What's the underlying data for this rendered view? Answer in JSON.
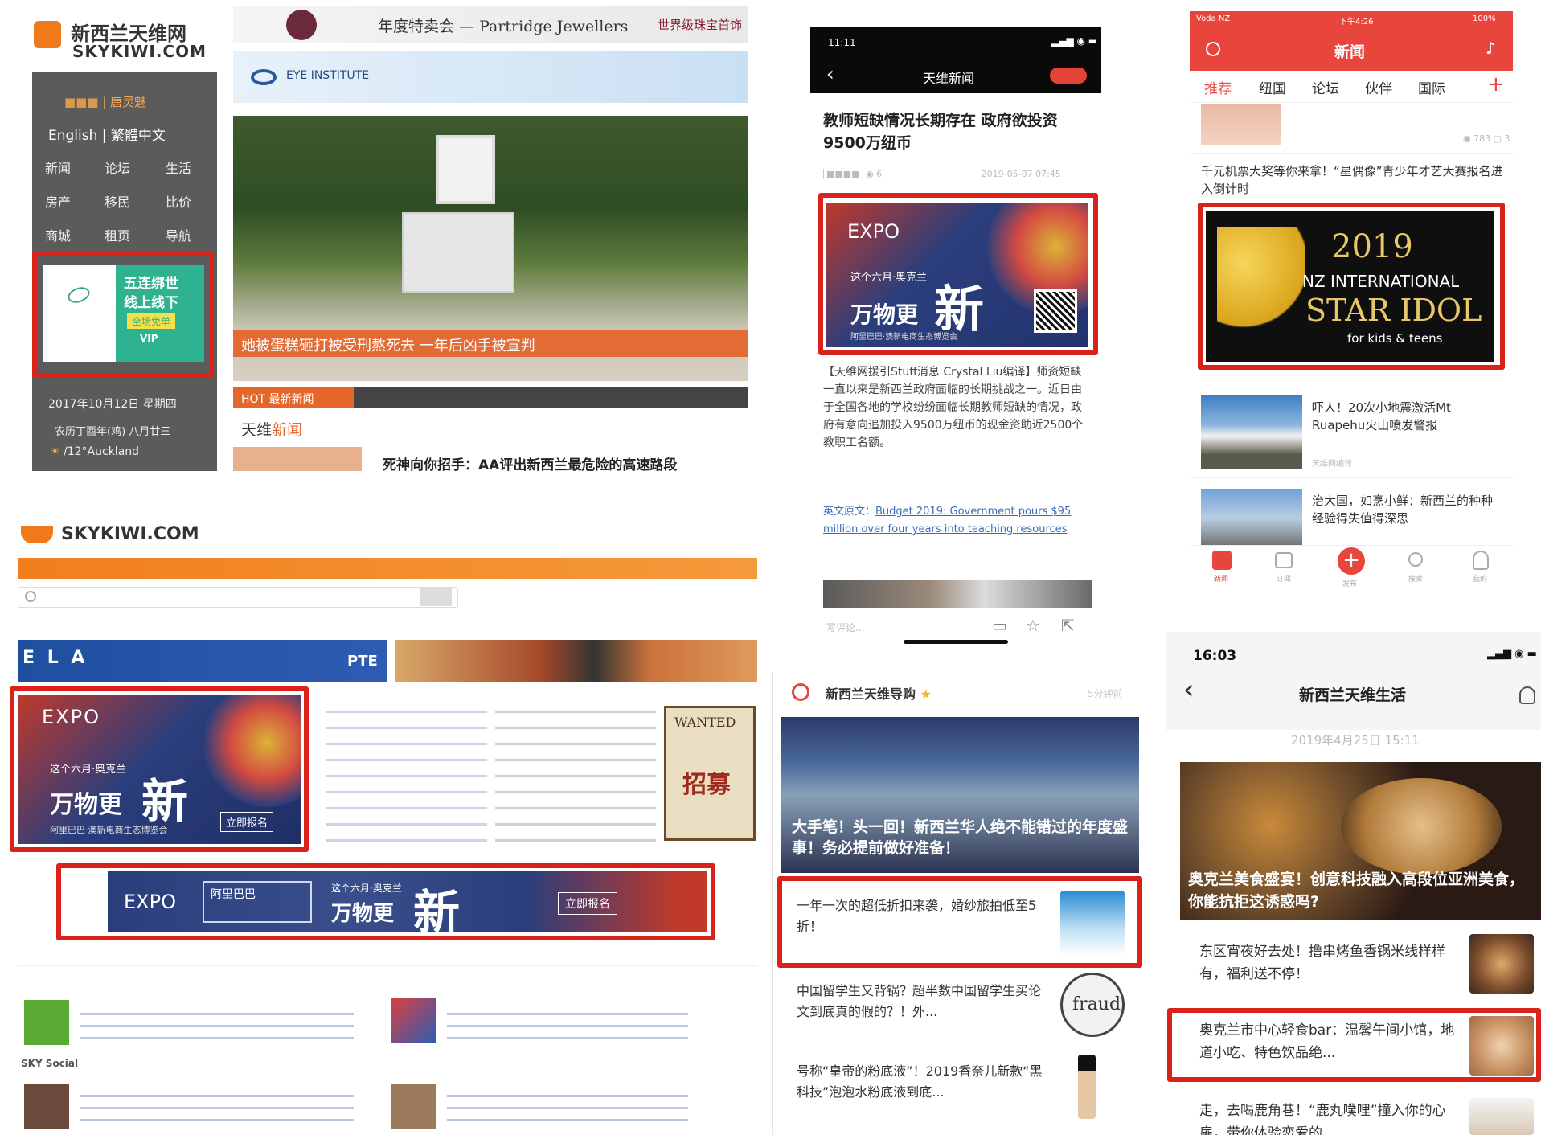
{
  "panelA": {
    "logo_cn": "新西兰天维网",
    "logo_en": "SKYKIWI.COM",
    "top_banner": "年度特卖会 — Partridge Jewellers",
    "top_banner_right": "世界级珠宝首饰",
    "eye_banner": "EYE INSTITUTE",
    "user_links": "| 唐灵魅",
    "lang": "English | 繁體中文",
    "nav": [
      "新闻",
      "论坛",
      "生活",
      "房产",
      "移民",
      "比价",
      "商城",
      "租页",
      "导航"
    ],
    "side_ad_line1": "五连绑世",
    "side_ad_line2": "线上线下",
    "side_ad_btn": "全场免单",
    "side_ad_vip": "VIP",
    "date": "2017年10月12日 星期四",
    "lunar": "农历丁酉年(鸡) 八月廿三",
    "weather": "/12°Auckland",
    "headline_overlay": "她被蛋糕砸打被受刑熬死去 一年后凶手被宣判",
    "hot_tab": "HOT 最新新闻",
    "section": "天维",
    "section_accent": "新闻",
    "story": "死神向你招手：AA评出新西兰最危险的高速路段"
  },
  "panelB": {
    "logo_en": "SKYKIWI.COM",
    "ad_expo_big": "万物更",
    "ad_expo_xin": "新",
    "ad_expo_sub": "阿里巴巴·澳新电商生态博览会",
    "ad_expo_line": "这个六月·奥克兰",
    "ad_expo_brand": "EXPO",
    "ad_expo_btn": "立即报名",
    "banner_brand": "阿里巴巴",
    "banner_big": "万物更",
    "banner_xin": "新",
    "banner_line": "这个六月·奥克兰",
    "banner_btn": "立即报名",
    "ela": "E L A",
    "ela_pte": "PTE",
    "wanted": "WANTED",
    "wanted_cn": "招募",
    "sky_social": "SKY Social"
  },
  "panelC": {
    "time": "11:11",
    "nav_title": "天维新闻",
    "headline": "教师短缺情况长期存在 政府欲投资9500万纽币",
    "meta_date": "2019-05-07 07:45",
    "ad_big": "万物更",
    "ad_xin": "新",
    "ad_line": "这个六月·奥克兰",
    "ad_brand": "EXPO",
    "ad_sub": "阿里巴巴·澳新电商生态博览会",
    "body": "【天维网援引Stuff消息 Crystal Liu编译】师资短缺一直以来是新西兰政府面临的长期挑战之一。近日由于全国各地的学校纷纷面临长期教师短缺的情况，政府有意向追加投入9500万纽币的现金资助近2500个教职工名额。",
    "source_label": "英文原文：",
    "source_link": "Budget 2019: Government pours $95 million over four years into teaching resources",
    "comment_placeholder": "写评论..."
  },
  "panelD": {
    "carrier": "Voda NZ",
    "time": "下午4:26",
    "battery": "100%",
    "title": "新闻",
    "tabs": [
      "推荐",
      "纽国",
      "论坛",
      "伙伴",
      "国际"
    ],
    "story1": "千元机票大奖等你来拿！“星偶像”青少年才艺大赛报名进入倒计时",
    "ad_year": "2019",
    "ad_l1": "NZ INTERNATIONAL",
    "ad_l2": "STAR IDOL",
    "ad_l3": "for kids & teens",
    "story2": "吓人！20次小地震激活Mt Ruapehu火山喷发警报",
    "story3": "治大国，如烹小鲜：新西兰的种种经验得失值得深思",
    "source": "天维网编译",
    "tabbar": [
      "新闻",
      "订阅",
      "发布",
      "搜索",
      "我的"
    ]
  },
  "panelE": {
    "account": "新西兰天维导购",
    "ago": "5分钟前",
    "hero_text": "大手笔！头一回！新西兰华人绝不能错过的年度盛事！务必提前做好准备！",
    "item1": "一年一次的超低折扣来袭，婚纱旅拍低至5折！",
    "item2": "中国留学生又背锅？超半数中国留学生买论文到底真的假的？！外...",
    "item3": "号称“皇帝的粉底液”！2019香奈儿新款“黑科技”泡泡水粉底液到底...",
    "fraud": "fraud"
  },
  "panelF": {
    "time": "16:03",
    "title": "新西兰天维生活",
    "date": "2019年4月25日 15:11",
    "hero_text": "奥克兰美食盛宴！创意科技融入高段位亚洲美食，你能抗拒这诱惑吗?",
    "item1": "东区宵夜好去处！撸串烤鱼香锅米线样样有，福利送不停！",
    "item2": "奥克兰市中心轻食bar：温馨午间小馆，地道小吃、特色饮品绝...",
    "item3": "走，去喝鹿角巷！“鹿丸噗哩”撞入你的心扉，带你体验恋爱的..."
  },
  "colors": {
    "highlight": "#d9231a",
    "skykiwi_orange": "#f07a1a",
    "app_red": "#e8453c",
    "expo_navy": "#2b3e7c"
  }
}
